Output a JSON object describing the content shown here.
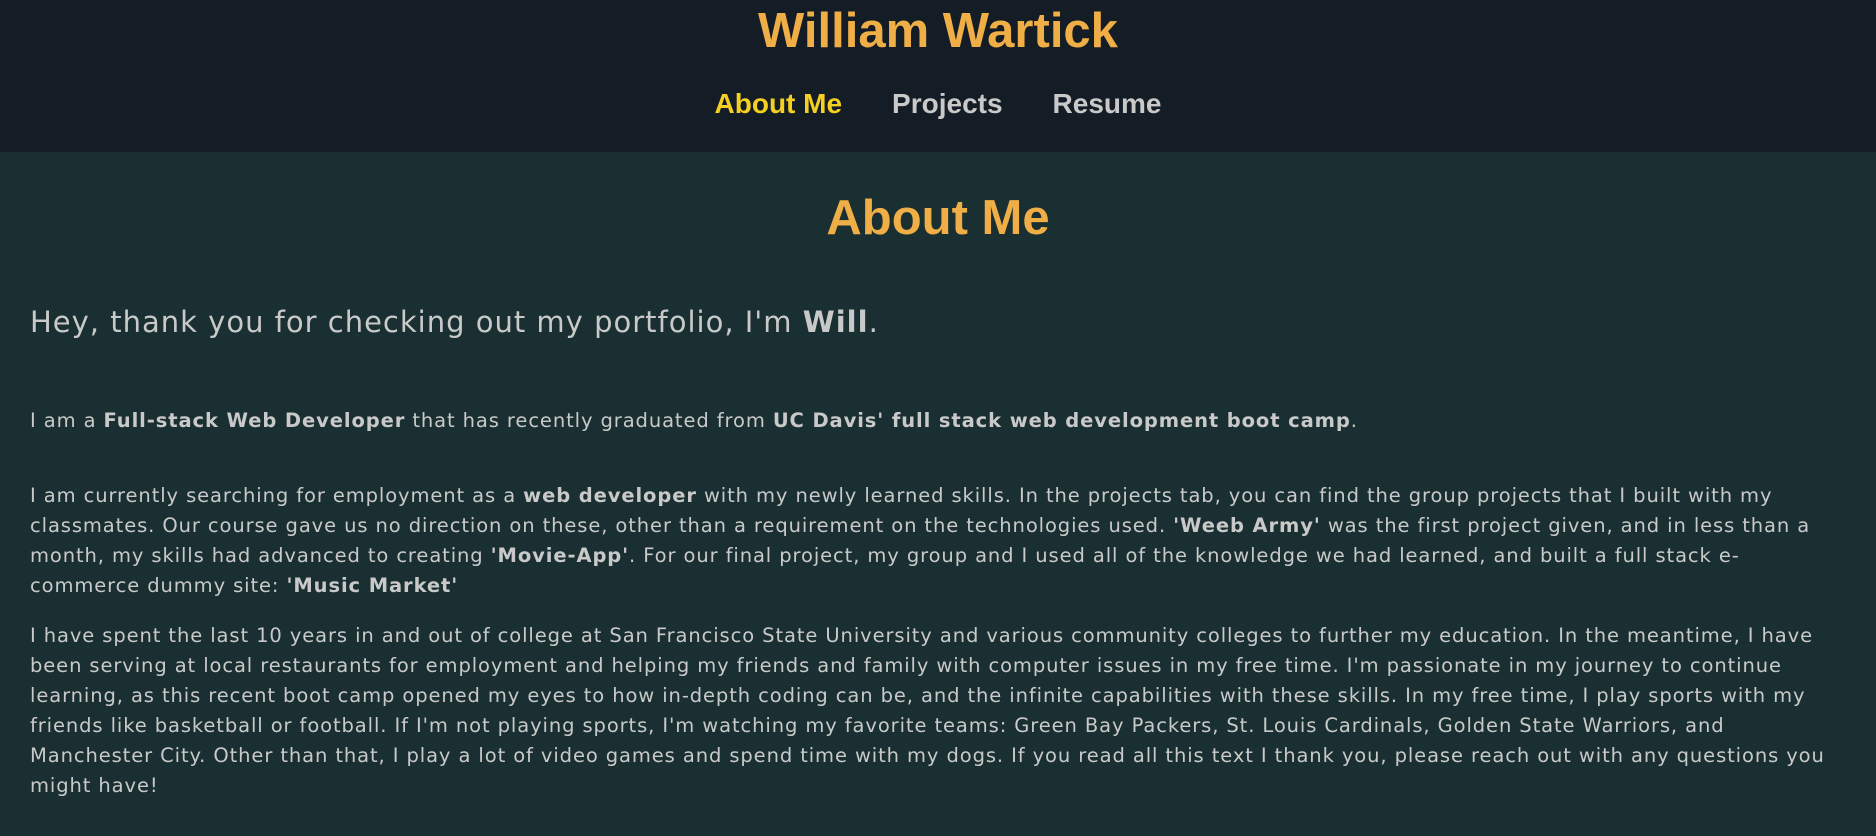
{
  "header": {
    "title": "William Wartick",
    "nav": [
      {
        "label": "About Me",
        "active": true
      },
      {
        "label": "Projects",
        "active": false
      },
      {
        "label": "Resume",
        "active": false
      }
    ]
  },
  "main": {
    "heading": "About Me",
    "intro": {
      "text_before": "Hey, thank you for checking out my portfolio, I'm ",
      "name": "Will",
      "text_after": "."
    },
    "paragraph1": {
      "t1": "I am a ",
      "b1": "Full-stack Web Developer",
      "t2": " that has recently graduated from ",
      "b2": "UC Davis' full stack web development boot camp",
      "t3": "."
    },
    "paragraph2": {
      "t1": "I am currently searching for employment as a ",
      "b1": "web developer",
      "t2": " with my newly learned skills. In the projects tab, you can find the group projects that I built with my classmates. Our course gave us no direction on these, other than a requirement on the technologies used. ",
      "b2": "'Weeb Army'",
      "t3": " was the first project given, and in less than a month, my skills had advanced to creating ",
      "b3": "'Movie-App'",
      "t4": ". For our final project, my group and I used all of the knowledge we had learned, and built a full stack e-commerce dummy site: ",
      "b4": "'Music Market'"
    },
    "paragraph3": "I have spent the last 10 years in and out of college at San Francisco State University and various community colleges to further my education. In the meantime, I have been serving at local restaurants for employment and helping my friends and family with computer issues in my free time. I'm passionate in my journey to continue learning, as this recent boot camp opened my eyes to how in-depth coding can be, and the infinite capabilities with these skills. In my free time, I play sports with my friends like basketball or football. If I'm not playing sports, I'm watching my favorite teams: Green Bay Packers, St. Louis Cardinals, Golden State Warriors, and Manchester City. Other than that, I play a lot of video games and spend time with my dogs. If you read all this text I thank you, please reach out with any questions you might have!"
  },
  "colors": {
    "header_bg": "#141d25",
    "page_bg": "#1a2f31",
    "accent_orange": "#f0ae46",
    "active_nav_yellow": "#f5d020",
    "body_text": "#c9c9c9"
  }
}
